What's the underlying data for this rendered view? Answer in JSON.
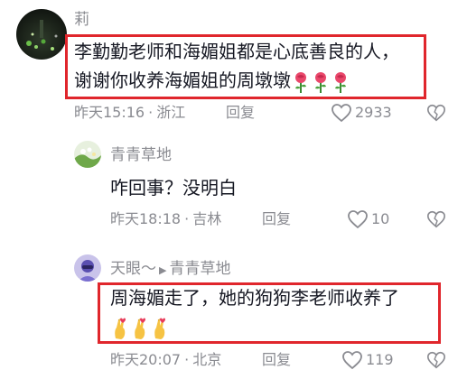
{
  "comments": [
    {
      "username": "莉",
      "text_line1": "李勤勤老师和海媚姐都是心底善良的人，",
      "text_line2": "谢谢你收养海媚姐的周墩墩",
      "emoji_icons": [
        "rose-emoji",
        "rose-emoji",
        "rose-emoji"
      ],
      "time": "昨天15:16",
      "location": "浙江",
      "reply_label": "回复",
      "likes": "2933"
    },
    {
      "username": "青青草地",
      "text": "咋回事？没明白",
      "time": "昨天18:18",
      "location": "吉林",
      "reply_label": "回复",
      "likes": "10"
    },
    {
      "username": "天眼～",
      "reply_to": "青青草地",
      "text": "周海媚走了，她的狗狗李老师收养了",
      "emoji_icons": [
        "pinched-fingers-emoji",
        "pinched-fingers-emoji",
        "pinched-fingers-emoji"
      ],
      "time": "昨天20:07",
      "location": "北京",
      "reply_label": "回复",
      "likes": "119"
    }
  ],
  "dot_separator": "·",
  "colors": {
    "highlight": "#e0262c",
    "meta_text": "#8a8b91",
    "body_text": "#161823"
  }
}
